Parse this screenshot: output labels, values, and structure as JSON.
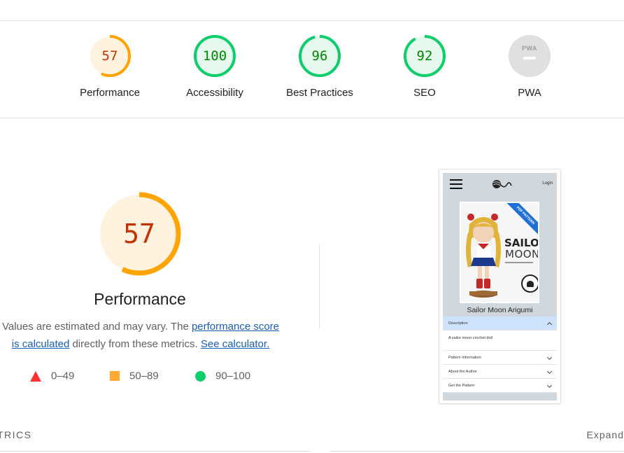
{
  "categories": [
    {
      "label": "Performance",
      "score": "57",
      "value": 57,
      "color": "#ffa400",
      "bg": "#fff3e0",
      "text_color": "#c33300"
    },
    {
      "label": "Accessibility",
      "score": "100",
      "value": 100,
      "color": "#0cce6b",
      "bg": "#e6f9ee",
      "text_color": "#008800"
    },
    {
      "label": "Best Practices",
      "score": "96",
      "value": 96,
      "color": "#0cce6b",
      "bg": "#e6f9ee",
      "text_color": "#008800"
    },
    {
      "label": "SEO",
      "score": "92",
      "value": 92,
      "color": "#0cce6b",
      "bg": "#e6f9ee",
      "text_color": "#008800"
    },
    {
      "label": "PWA",
      "badge": "PWA"
    }
  ],
  "performance": {
    "score": "57",
    "value": 57,
    "title": "Performance",
    "desc_pre": "Values are estimated and may vary. The ",
    "link_score": "performance score is calculated",
    "desc_mid": " directly from these metrics. ",
    "link_calc": "See calculator."
  },
  "legend": [
    {
      "symbol": "triangle-icon",
      "range": "0–49",
      "color": "#ff3333"
    },
    {
      "symbol": "square-icon",
      "range": "50–89",
      "color": "#ffaa33"
    },
    {
      "symbol": "circle-icon",
      "range": "90–100",
      "color": "#0cce6b"
    }
  ],
  "screenshot": {
    "login": "Login",
    "ribbon": "PDF PATTERN",
    "poster_title_1": "SAILOR",
    "poster_title_2": "MOON",
    "title": "Sailor Moon Arigumi",
    "accordion": [
      {
        "label": "Description",
        "open": true,
        "body": "A sailor moon crochet doll"
      },
      {
        "label": "Pattern Information"
      },
      {
        "label": "About the Author"
      },
      {
        "label": "Get the Pattern"
      }
    ]
  },
  "metrics_label": "TRICS",
  "expand_label": "Expand"
}
